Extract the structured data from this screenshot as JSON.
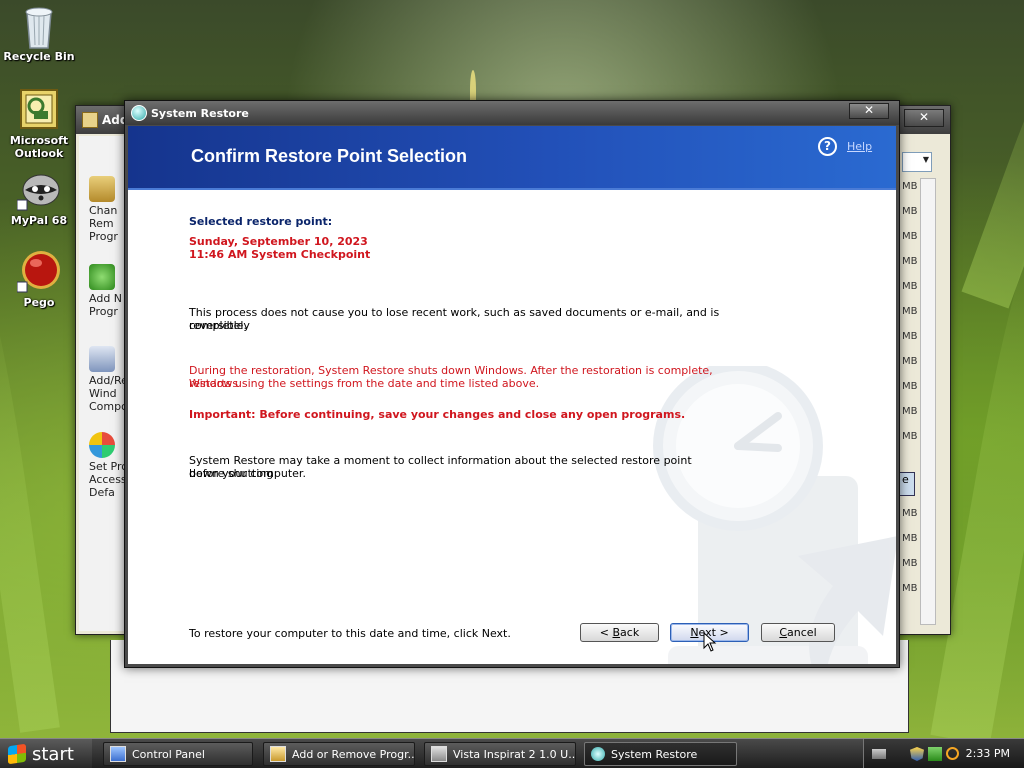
{
  "desktop": {
    "icons": [
      {
        "label_line1": "Recycle Bin",
        "label_line2": "",
        "icon": "recycle-bin-icon"
      },
      {
        "label_line1": "Microsoft",
        "label_line2": "Outlook",
        "icon": "outlook-icon"
      },
      {
        "label_line1": "MyPal 68",
        "label_line2": "",
        "icon": "mypal-icon"
      },
      {
        "label_line1": "Pego",
        "label_line2": "",
        "icon": "pego-icon"
      }
    ]
  },
  "background_window": {
    "title": "Add",
    "left_items": [
      {
        "l1": "Chan",
        "l2": "Rem",
        "l3": "Progr"
      },
      {
        "l1": "Add N",
        "l2": "Progr",
        "l3": ""
      },
      {
        "l1": "Add/Re",
        "l2": "Wind",
        "l3": "Compo"
      },
      {
        "l1": "Set Pro",
        "l2": "Access",
        "l3": "Defa"
      }
    ],
    "sizes": [
      "MB",
      "MB",
      "MB",
      "MB",
      "MB",
      "MB",
      "MB",
      "MB",
      "MB",
      "MB",
      "MB"
    ],
    "sizes_lower": [
      "MB",
      "MB",
      "MB",
      "MB"
    ],
    "partial_button": "e"
  },
  "dialog": {
    "window_title": "System Restore",
    "heading": "Confirm Restore Point Selection",
    "help_label": "Help",
    "selected_label": "Selected restore point:",
    "restore_date": "Sunday, September 10, 2023",
    "restore_desc": "11:46 AM System Checkpoint",
    "para1_line1": "This process does not cause you to lose recent work, such as saved documents or e-mail, and is completely",
    "para1_line2": "reversible.",
    "para2_line1": "During the restoration, System Restore shuts down Windows. After the restoration is complete, Windows",
    "para2_line2": "restarts using the settings from the date and time listed above.",
    "important": "Important: Before continuing, save your changes and close any open programs.",
    "para3_line1": "System Restore may take a moment to collect information about the selected restore point before shutting",
    "para3_line2": "down your computer.",
    "footer_text": "To restore your computer to this date and time, click Next.",
    "back_prefix": "< ",
    "back_key": "B",
    "back_rest": "ack",
    "next_key": "N",
    "next_rest": "ext >",
    "cancel_key": "C",
    "cancel_rest": "ancel"
  },
  "taskbar": {
    "start_label": "start",
    "tasks": [
      {
        "label": "Control Panel",
        "active": false
      },
      {
        "label": "Add or Remove Progr...",
        "active": false
      },
      {
        "label": "Vista Inspirat 2 1.0 U...",
        "active": false
      },
      {
        "label": "System Restore",
        "active": true
      }
    ],
    "clock": "2:33 PM"
  },
  "colors": {
    "header_blue": "#2250b8",
    "navy_text": "#0a246a",
    "warning_red": "#d0161e"
  }
}
